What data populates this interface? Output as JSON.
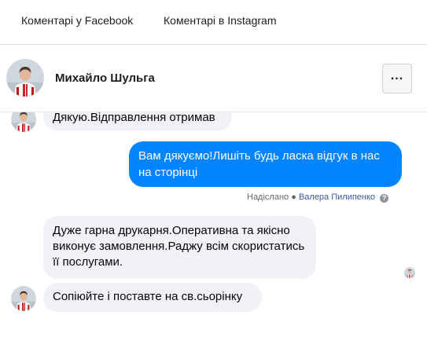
{
  "tabs": [
    {
      "label": "Коментарі у Facebook"
    },
    {
      "label": "Коментарі в Instagram"
    }
  ],
  "header": {
    "contact_name": "Михайло Шульга",
    "more_label": "..."
  },
  "messages": [
    {
      "direction": "incoming",
      "text": "Дякую.Відправлення отримав"
    },
    {
      "direction": "outgoing",
      "text": "Вам дякуємо!Лишіть будь ласка відгук в нас на сторінці"
    },
    {
      "direction": "incoming",
      "text": "Дуже гарна друкарня.Оперативна та якісно виконує замовлення.Раджу всім скористатись її послугами."
    },
    {
      "direction": "incoming",
      "text": "Сопіюйте і поставте на св.сьорінку"
    }
  ],
  "sent_meta": {
    "status": "Надіслано",
    "sender": "Валера Пилипенко",
    "help_icon": "?"
  },
  "colors": {
    "outgoing_bubble": "#0084ff",
    "incoming_bubble": "#f0f2f5",
    "sender_link": "#385898"
  },
  "icons": [
    "more-options-icon",
    "help-icon",
    "avatar"
  ]
}
